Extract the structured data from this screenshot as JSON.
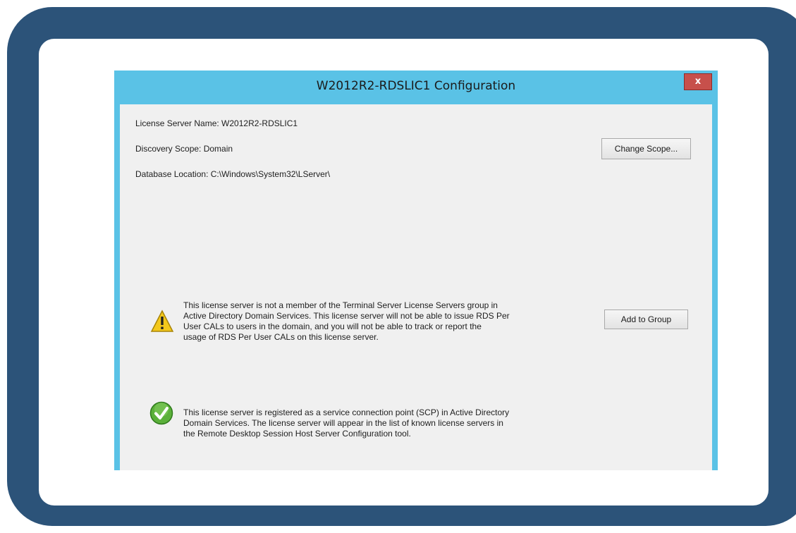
{
  "window": {
    "title": "W2012R2-RDSLIC1 Configuration",
    "close_glyph": "x"
  },
  "info": {
    "server_name": "License Server Name: W2012R2-RDSLIC1",
    "discovery_scope": "Discovery Scope: Domain",
    "database_location": "Database Location: C:\\Windows\\System32\\LServer\\"
  },
  "buttons": {
    "change_scope": "Change Scope...",
    "add_to_group": "Add to Group"
  },
  "messages": {
    "warning": {
      "icon": "warning-icon",
      "lines": [
        "This license server is not a member of the Terminal Server License Servers group in",
        "Active Directory Domain Services. This license server will not be able to issue RDS Per",
        "User CALs to users in the domain, and you will not be able to track or report the",
        "usage of RDS Per User CALs on this license server."
      ]
    },
    "success": {
      "icon": "check-icon",
      "lines": [
        "This license server is registered as a service connection point (SCP) in Active Directory",
        "Domain Services. The license server will appear in the list of known license servers in",
        "the Remote Desktop Session Host Server Configuration tool."
      ]
    }
  },
  "colors": {
    "frame": "#2c5379",
    "titlebar": "#5ac2e6",
    "close": "#c7504b",
    "client": "#f0f0f0"
  }
}
